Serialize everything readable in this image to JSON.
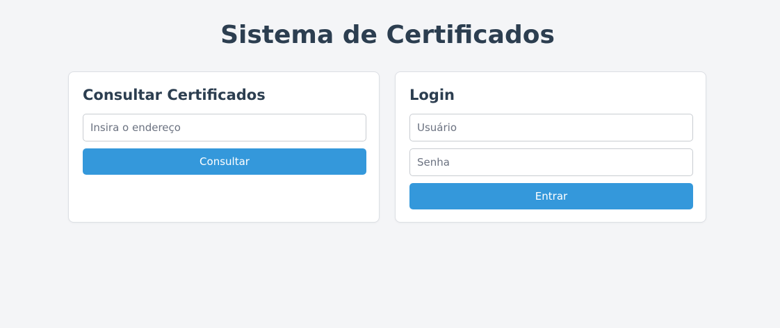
{
  "page": {
    "title": "Sistema de Certificados"
  },
  "consult": {
    "title": "Consultar Certificados",
    "address_placeholder": "Insira o endereço",
    "address_value": "",
    "button_label": "Consultar"
  },
  "login": {
    "title": "Login",
    "username_placeholder": "Usuário",
    "username_value": "",
    "password_placeholder": "Senha",
    "password_value": "",
    "button_label": "Entrar"
  },
  "colors": {
    "background": "#f4f5f7",
    "primary": "#3498db",
    "text": "#2c3e50",
    "card": "#ffffff"
  }
}
